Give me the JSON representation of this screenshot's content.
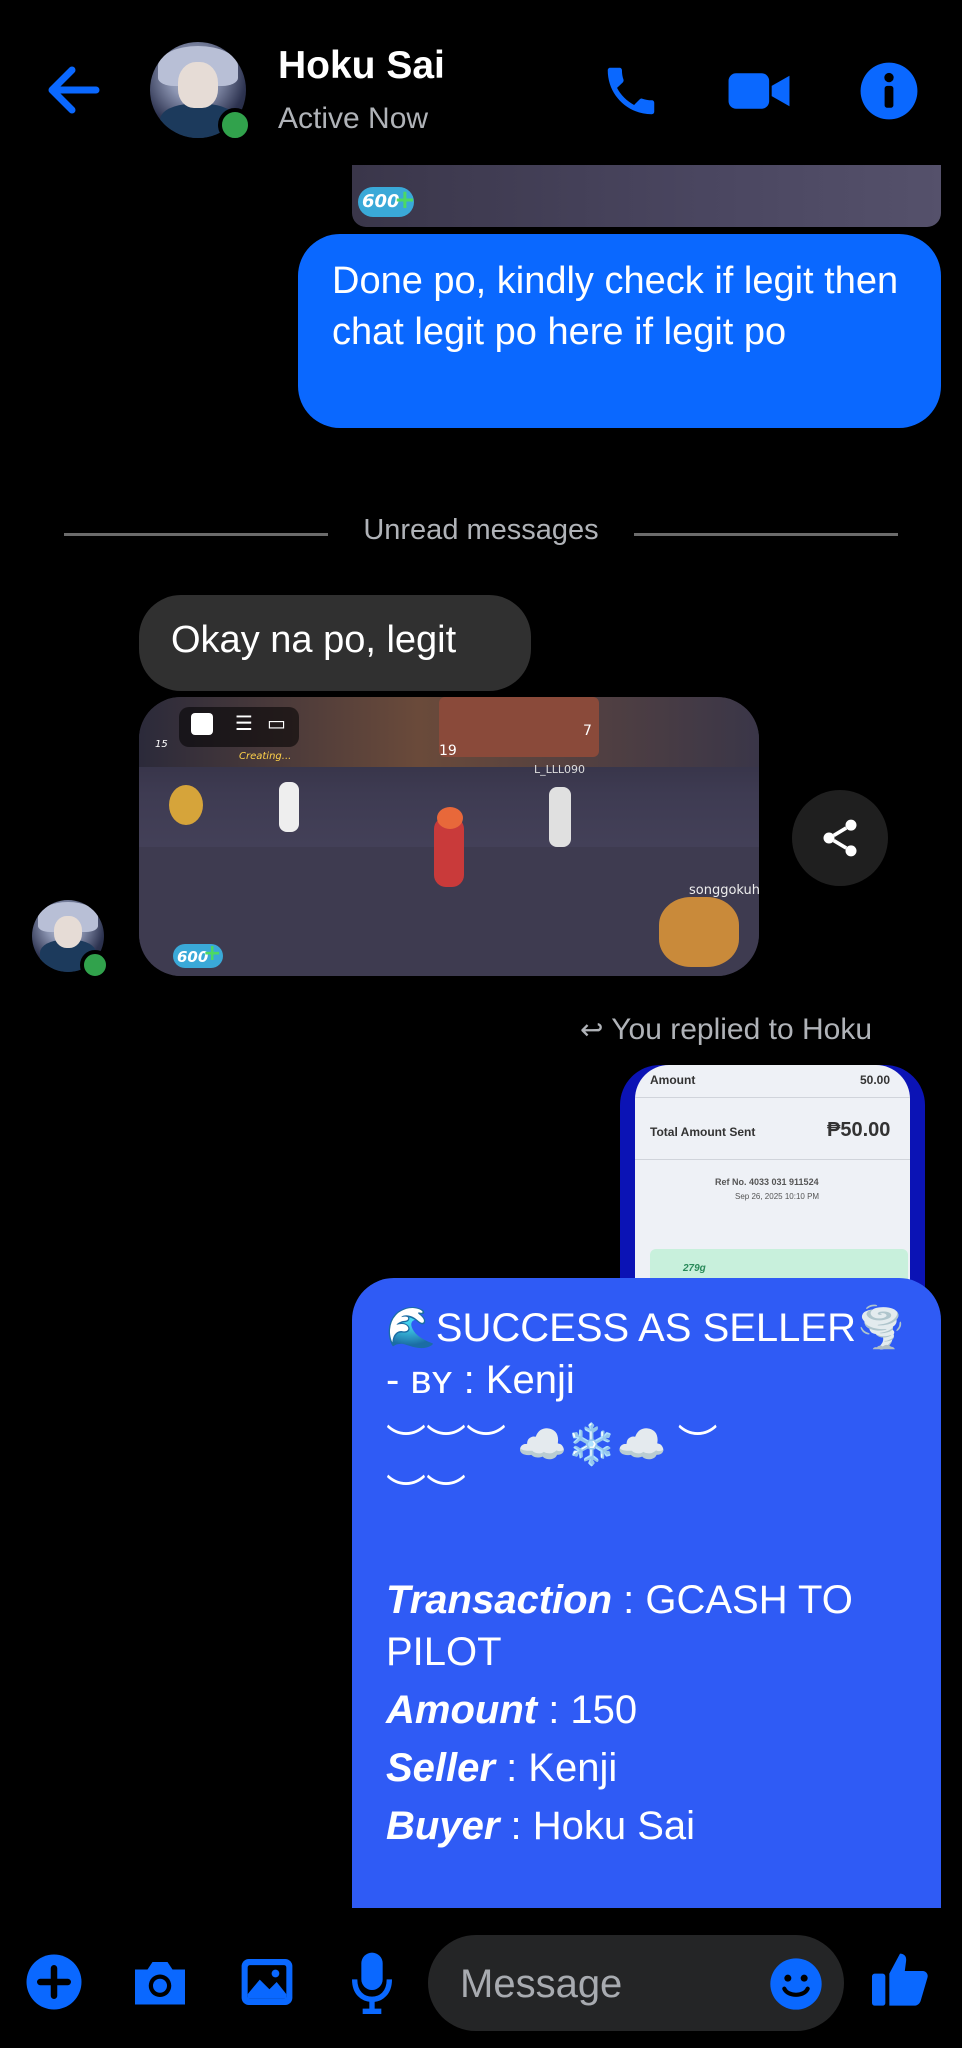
{
  "header": {
    "contact_name": "Hoku Sai",
    "status": "Active Now",
    "icons": [
      "back-arrow-icon",
      "phone-icon",
      "video-call-icon",
      "info-icon"
    ]
  },
  "colors": {
    "accent": "#0a68ff",
    "outgoing_bubble": "#0a68ff",
    "incoming_bubble": "#303030",
    "online": "#31a24c",
    "background": "#000000"
  },
  "messages": {
    "image_badge": "600",
    "outgoing_1": "Done po, kindly check if legit then chat legit po here if legit po",
    "divider": "Unread messages",
    "incoming_1": "Okay na po, legit",
    "game_image": {
      "username_tag": "songgokuh",
      "player_name": "L_LLL090",
      "badge": "600",
      "counter_1": "7",
      "counter_2": "19",
      "counter_3": "15",
      "status_text": "Creating..."
    },
    "reply_label": "You replied to Hoku",
    "receipt": {
      "amount_label": "Amount",
      "amount_value": "50.00",
      "total_label": "Total Amount Sent",
      "total_value": "₱50.00",
      "ref": "Ref No. 4033 031 911524",
      "date": "Sep 26, 2025 10:10 PM",
      "bottom_text": "279g"
    },
    "outgoing_2": {
      "title": "🌊SUCCESS AS SELLER🌪️",
      "byline": "- ʙʏ : Kenji",
      "deco_1": "︶︶︶ ☁️❄️☁️ ︶",
      "deco_2": "︶︶",
      "transaction_label": "Transaction",
      "transaction_value": " : GCASH TO",
      "transaction_value_2": "PILOT",
      "amount_label": "Amount",
      "amount_value": " : 150",
      "seller_label": "Seller",
      "seller_value": " : Kenji",
      "buyer_label": "Buyer",
      "buyer_value": " : Hoku Sai"
    }
  },
  "composer": {
    "placeholder": "Message",
    "icons": [
      "plus-icon",
      "camera-icon",
      "gallery-icon",
      "microphone-icon",
      "emoji-icon",
      "thumbs-up-icon"
    ]
  }
}
